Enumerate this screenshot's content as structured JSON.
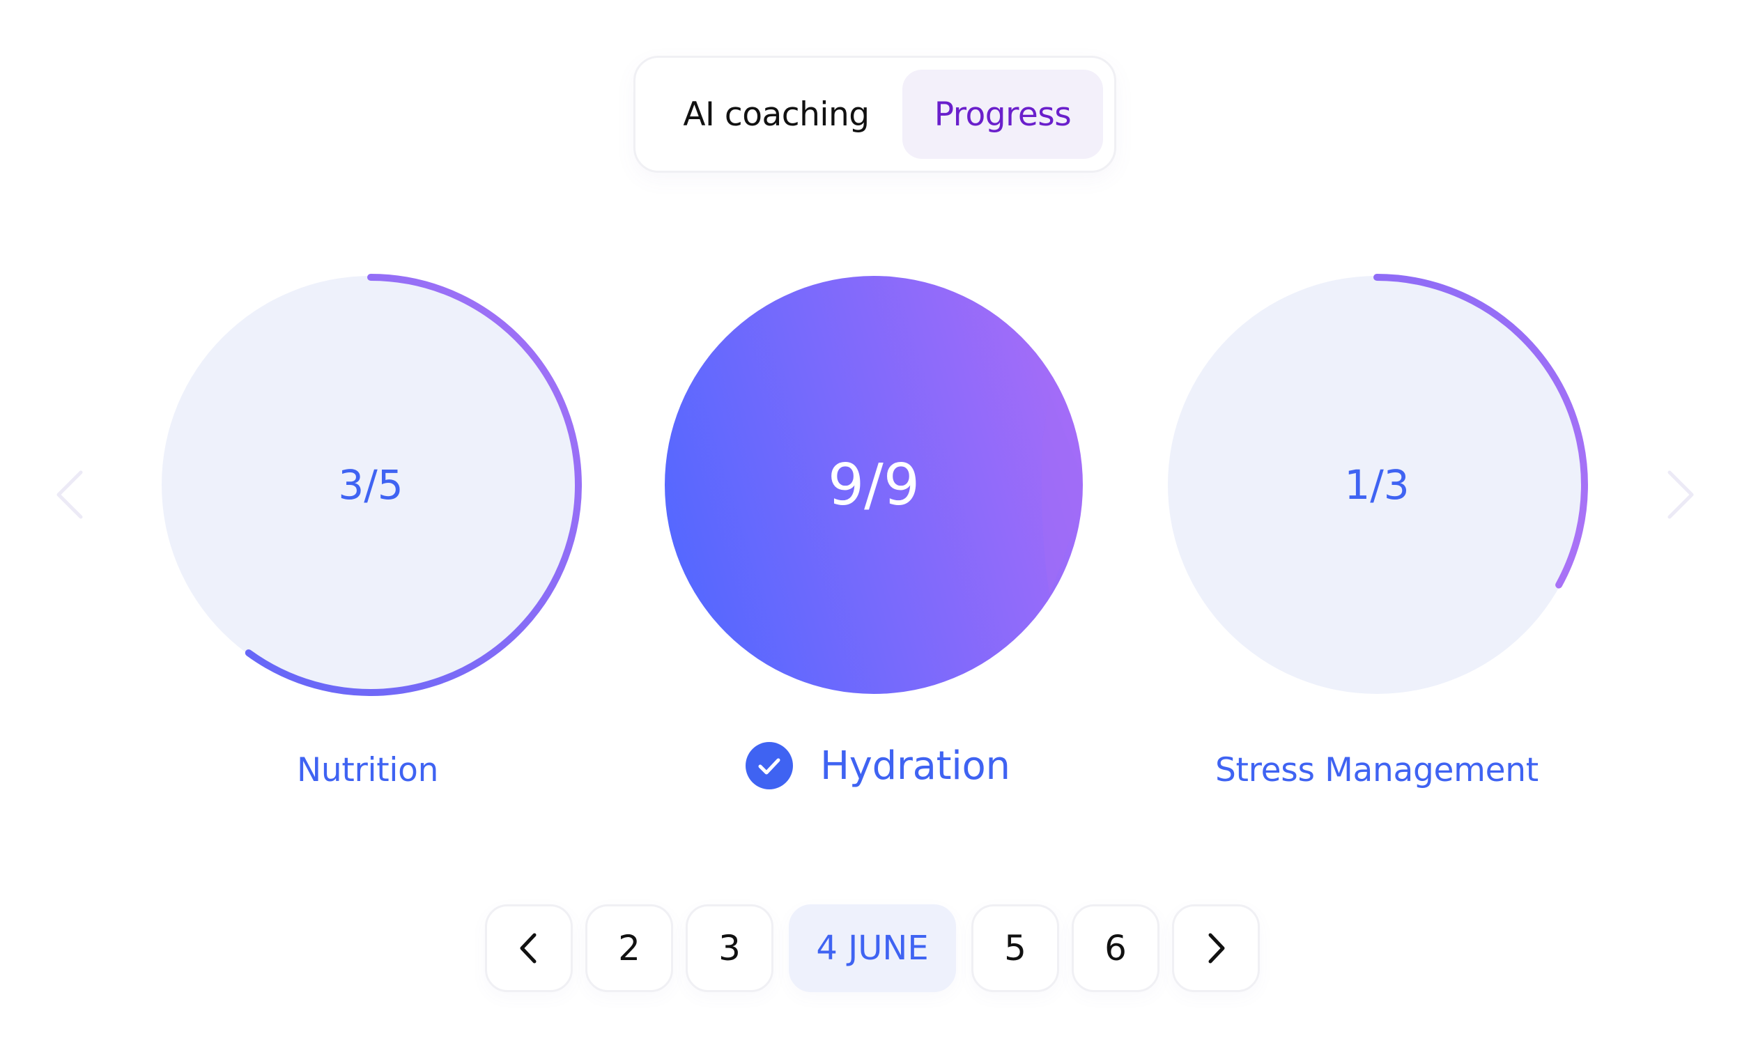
{
  "tabs": [
    {
      "label": "AI coaching",
      "active": false
    },
    {
      "label": "Progress",
      "active": true
    }
  ],
  "habits": [
    {
      "name": "Nutrition",
      "value_text": "3/5",
      "completed": 3,
      "total": 5,
      "progress": 0.6,
      "selected": false
    },
    {
      "name": "Hydration",
      "value_text": "9/9",
      "completed": 9,
      "total": 9,
      "progress": 1.0,
      "selected": true
    },
    {
      "name": "Stress Management",
      "value_text": "1/3",
      "completed": 1,
      "total": 3,
      "progress": 0.33,
      "selected": false
    }
  ],
  "carousel": {
    "prev_icon": "chevron-left-icon",
    "next_icon": "chevron-right-icon"
  },
  "pager": {
    "prev_icon": "chevron-left-icon",
    "next_icon": "chevron-right-icon",
    "days": [
      "2",
      "3",
      "4 JUNE",
      "5",
      "6"
    ],
    "active_index": 2
  },
  "colors": {
    "accent_blue": "#3f63f2",
    "accent_purple": "#6a1fcb",
    "ring_track": "#eef1fb",
    "gradient_start": "#5468ff",
    "gradient_end": "#a36af8"
  }
}
